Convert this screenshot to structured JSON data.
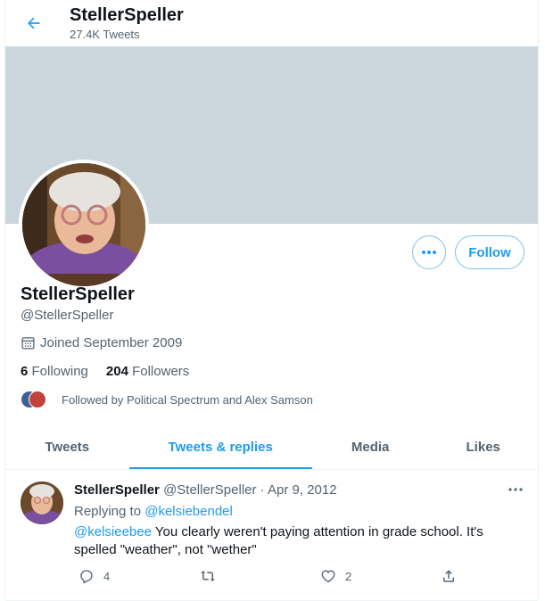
{
  "header": {
    "title": "StellerSpeller",
    "subtitle": "27.4K Tweets"
  },
  "profile": {
    "name": "StellerSpeller",
    "handle": "@StellerSpeller",
    "joined": "Joined September 2009",
    "following_count": "6",
    "following_label": "Following",
    "followers_count": "204",
    "followers_label": "Followers",
    "followed_by": "Followed by Political Spectrum and Alex Samson",
    "follow_label": "Follow"
  },
  "tabs": [
    {
      "label": "Tweets"
    },
    {
      "label": "Tweets & replies"
    },
    {
      "label": "Media"
    },
    {
      "label": "Likes"
    }
  ],
  "tweet": {
    "name": "StellerSpeller",
    "meta": "@StellerSpeller · Apr 9, 2012",
    "replying_prefix": "Replying to",
    "replying_to": "@kelsiebendel",
    "mention": "@kelsieebee",
    "text": " You clearly weren't paying attention in grade school. It's spelled \"weather\", not \"wether\"",
    "reply_count": "4",
    "like_count": "2"
  },
  "colors": {
    "accent": "#1d9bf0",
    "banner": "#ccd6dd",
    "muted": "#536471"
  },
  "icons": [
    "back-arrow-icon",
    "more-icon",
    "calendar-icon",
    "reply-icon",
    "retweet-icon",
    "like-icon",
    "share-icon"
  ]
}
